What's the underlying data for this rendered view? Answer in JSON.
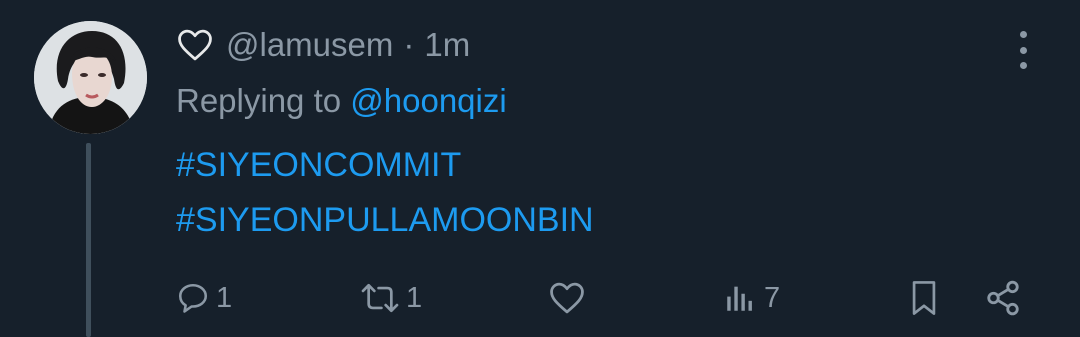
{
  "tweet": {
    "handle": "@lamusem",
    "separator": "·",
    "time": "1m",
    "reply_prefix": "Replying to ",
    "reply_handle": "@hoonqizi",
    "hashtags": [
      "#SIYEONCOMMIT",
      "#SIYEONPULLAMOONBIN"
    ]
  },
  "actions": {
    "replies": "1",
    "retweets": "1",
    "views": "7"
  },
  "colors": {
    "background": "#16202b",
    "text_secondary": "#8b98a5",
    "link": "#1d9bf0",
    "thread_line": "#3f4f5c"
  },
  "icons": [
    "heart-icon",
    "more-icon",
    "reply-icon",
    "retweet-icon",
    "like-icon",
    "views-icon",
    "bookmark-icon",
    "share-icon"
  ]
}
